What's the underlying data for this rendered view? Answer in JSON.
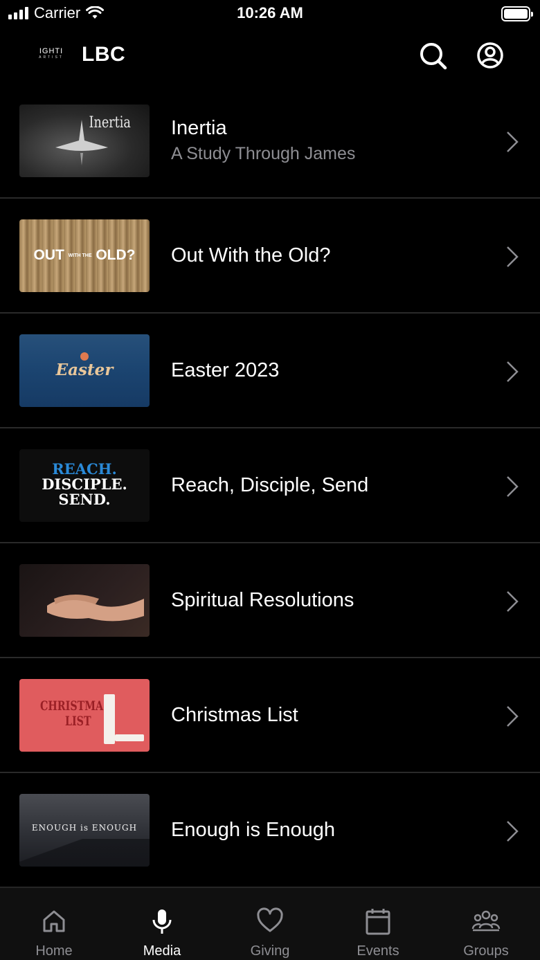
{
  "status_bar": {
    "carrier": "Carrier",
    "time": "10:26 AM",
    "battery_level": 1.0
  },
  "header": {
    "logo_text": "IGHTI",
    "logo_subtext": "ARTIST",
    "title": "LBC",
    "search_icon": "search-icon",
    "account_icon": "account-icon"
  },
  "series": [
    {
      "title": "Inertia",
      "subtitle": "A Study Through James",
      "thumb_text": "Inertia"
    },
    {
      "title": "Out With the Old?",
      "subtitle": "",
      "thumb_text_a": "OUT",
      "thumb_text_b": "WITH THE",
      "thumb_text_c": "OLD?"
    },
    {
      "title": "Easter 2023",
      "subtitle": "",
      "thumb_text": "Easter"
    },
    {
      "title": "Reach, Disciple, Send",
      "subtitle": "",
      "thumb_l1": "REACH.",
      "thumb_l2": "DISCIPLE.",
      "thumb_l3": "SEND."
    },
    {
      "title": "Spiritual Resolutions",
      "subtitle": ""
    },
    {
      "title": "Christmas List",
      "subtitle": "",
      "thumb_l1": "CHRISTMAS",
      "thumb_l2": "LIST"
    },
    {
      "title": "Enough is Enough",
      "subtitle": "",
      "thumb_text": "ENOUGH is ENOUGH"
    }
  ],
  "tabbar": {
    "tabs": [
      {
        "label": "Home",
        "icon": "home-icon",
        "active": false
      },
      {
        "label": "Media",
        "icon": "microphone-icon",
        "active": true
      },
      {
        "label": "Giving",
        "icon": "heart-icon",
        "active": false
      },
      {
        "label": "Events",
        "icon": "calendar-icon",
        "active": false
      },
      {
        "label": "Groups",
        "icon": "groups-icon",
        "active": false
      }
    ]
  },
  "colors": {
    "background": "#000000",
    "text_primary": "#ffffff",
    "text_secondary": "#8e8e93",
    "divider": "#2a2a2a"
  }
}
